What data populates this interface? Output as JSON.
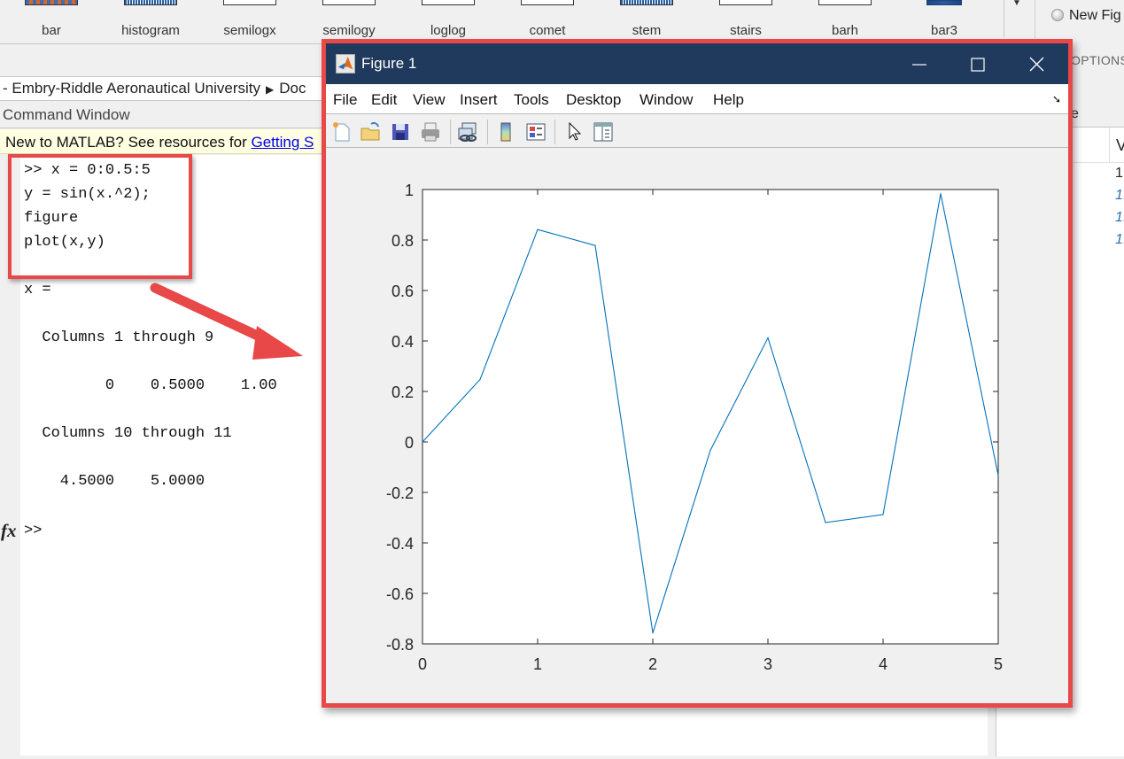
{
  "ribbon": {
    "gallery": [
      {
        "label": "bar",
        "icon": "bar-plot-icon"
      },
      {
        "label": "histogram",
        "icon": "histogram-plot-icon"
      },
      {
        "label": "semilogx",
        "icon": "semilogx-plot-icon"
      },
      {
        "label": "semilogy",
        "icon": "semilogy-plot-icon"
      },
      {
        "label": "loglog",
        "icon": "loglog-plot-icon"
      },
      {
        "label": "comet",
        "icon": "comet-plot-icon"
      },
      {
        "label": "stem",
        "icon": "stem-plot-icon"
      },
      {
        "label": "stairs",
        "icon": "stairs-plot-icon"
      },
      {
        "label": "barh",
        "icon": "barh-plot-icon"
      },
      {
        "label": "bar3",
        "icon": "bar3-plot-icon"
      }
    ],
    "new_figure_option": "New Fig",
    "options_section": "OPTIONS"
  },
  "address_bar": {
    "path_prefix": "- Embry-Riddle Aeronautical University",
    "path_next": "Doc"
  },
  "command_window": {
    "title": "Command Window",
    "banner_text": "New to MATLAB? See resources for ",
    "banner_link": "Getting S",
    "lines": [
      ">> x = 0:0.5:5",
      "y = sin(x.^2);",
      "figure",
      "plot(x,y)",
      "",
      "x =",
      "",
      "  Columns 1 through 9",
      "",
      "         0    0.5000    1.00",
      "",
      "  Columns 10 through 11",
      "",
      "    4.5000    5.0000"
    ],
    "prompt": ">>",
    "fx_label": "fx"
  },
  "workspace": {
    "header_partial": "e",
    "column_header": "V",
    "values": [
      "1",
      "1:",
      "1:",
      "1:"
    ]
  },
  "figure_window": {
    "title": "Figure 1",
    "menu": [
      "File",
      "Edit",
      "View",
      "Insert",
      "Tools",
      "Desktop",
      "Window",
      "Help"
    ],
    "toolbar": [
      "new-figure-icon",
      "open-file-icon",
      "save-icon",
      "print-icon",
      "link-plot-icon",
      "colorbar-icon",
      "legend-icon",
      "edit-plot-pointer-icon",
      "property-inspector-icon"
    ]
  },
  "colors": {
    "line": "#0072bd",
    "annotation": "#e84848",
    "titlebar": "#1f3a5c"
  },
  "chart_data": {
    "type": "line",
    "title": "",
    "xlabel": "",
    "ylabel": "",
    "xlim": [
      0,
      5
    ],
    "ylim": [
      -0.8,
      1
    ],
    "xticks": [
      0,
      1,
      2,
      3,
      4,
      5
    ],
    "yticks": [
      -0.8,
      -0.6,
      -0.4,
      -0.2,
      0,
      0.2,
      0.4,
      0.6,
      0.8,
      1
    ],
    "grid": false,
    "series": [
      {
        "name": "y = sin(x.^2)",
        "x": [
          0,
          0.5,
          1,
          1.5,
          2,
          2.5,
          3,
          3.5,
          4,
          4.5,
          5
        ],
        "y": [
          0,
          0.2474,
          0.8415,
          0.7781,
          -0.7568,
          -0.0332,
          0.4121,
          -0.3195,
          -0.2879,
          0.9834,
          -0.1324
        ]
      }
    ]
  }
}
